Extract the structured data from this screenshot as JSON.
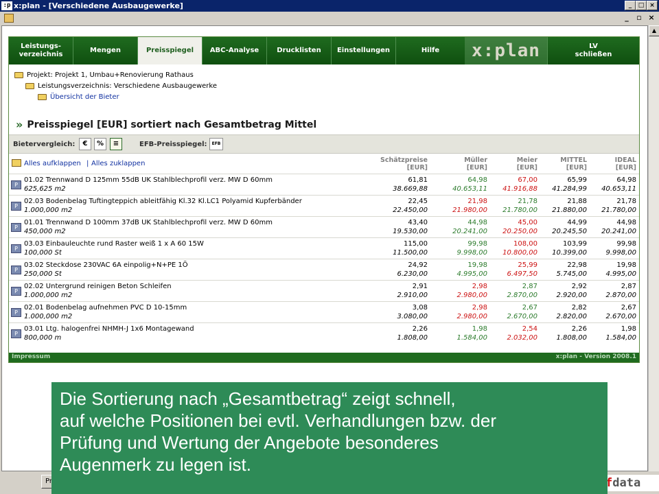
{
  "window": {
    "app_icon": ":p",
    "title": "x:plan - [Verschiedene Ausbaugewerke]"
  },
  "nav": {
    "items": [
      {
        "label": "Leistungs-\nverzeichnis"
      },
      {
        "label": "Mengen"
      },
      {
        "label": "Preisspiegel"
      },
      {
        "label": "ABC-Analyse"
      },
      {
        "label": "Drucklisten"
      },
      {
        "label": "Einstellungen"
      },
      {
        "label": "Hilfe"
      }
    ],
    "logo": "x:plan",
    "close_lv": "LV\nschließen"
  },
  "breadcrumb": {
    "project": "Projekt: Projekt 1, Umbau+Renovierung Rathaus",
    "lv": "Leistungsverzeichnis: Verschiedene Ausbaugewerke",
    "bidders": "Übersicht der Bieter"
  },
  "heading": {
    "raquo": "»",
    "text": "Preisspiegel [EUR] sortiert nach Gesamtbetrag Mittel"
  },
  "toolbar": {
    "bieter_label": "Bietervergleich:",
    "btn_euro": "€",
    "btn_percent": "%",
    "btn_list": "≡",
    "efb_label": "EFB-Preisspiegel:",
    "btn_efb": "EFB"
  },
  "expand": {
    "expand_all": "Alles aufklappen",
    "sep": "|",
    "collapse_all": "Alles zuklappen"
  },
  "columns": [
    {
      "line1": "Schätzpreise",
      "line2": "[EUR]"
    },
    {
      "line1": "Müller",
      "line2": "[EUR]"
    },
    {
      "line1": "Meier",
      "line2": "[EUR]"
    },
    {
      "line1": "MITTEL",
      "line2": "[EUR]"
    },
    {
      "line1": "IDEAL",
      "line2": "[EUR]"
    }
  ],
  "rows": [
    {
      "desc": "01.02 Trennwand D 125mm 55dB UK Stahlblechprofil verz. MW D 60mm",
      "qty": "625,625 m2",
      "ep": [
        "61,81",
        "64,98",
        "67,00",
        "65,99",
        "64,98"
      ],
      "gp": [
        "38.669,88",
        "40.653,11",
        "41.916,88",
        "41.284,99",
        "40.653,11"
      ],
      "colors": [
        "black",
        "green",
        "red",
        "black",
        "black"
      ]
    },
    {
      "desc": "02.03 Bodenbelag Tuftingteppich ableitfähig Kl.32 Kl.LC1 Polyamid Kupferbänder",
      "qty": "1.000,000 m2",
      "ep": [
        "22,45",
        "21,98",
        "21,78",
        "21,88",
        "21,78"
      ],
      "gp": [
        "22.450,00",
        "21.980,00",
        "21.780,00",
        "21.880,00",
        "21.780,00"
      ],
      "colors": [
        "black",
        "red",
        "green",
        "black",
        "black"
      ]
    },
    {
      "desc": "01.01 Trennwand D 100mm 37dB UK Stahlblechprofil verz. MW D 60mm",
      "qty": "450,000 m2",
      "ep": [
        "43,40",
        "44,98",
        "45,00",
        "44,99",
        "44,98"
      ],
      "gp": [
        "19.530,00",
        "20.241,00",
        "20.250,00",
        "20.245,50",
        "20.241,00"
      ],
      "colors": [
        "black",
        "green",
        "red",
        "black",
        "black"
      ]
    },
    {
      "desc": "03.03 Einbauleuchte rund Raster weiß 1 x A 60 15W",
      "qty": "100,000 St",
      "ep": [
        "115,00",
        "99,98",
        "108,00",
        "103,99",
        "99,98"
      ],
      "gp": [
        "11.500,00",
        "9.998,00",
        "10.800,00",
        "10.399,00",
        "9.998,00"
      ],
      "colors": [
        "black",
        "green",
        "red",
        "black",
        "black"
      ]
    },
    {
      "desc": "03.02 Steckdose 230VAC 6A einpolig+N+PE 1Ö",
      "qty": "250,000 St",
      "ep": [
        "24,92",
        "19,98",
        "25,99",
        "22,98",
        "19,98"
      ],
      "gp": [
        "6.230,00",
        "4.995,00",
        "6.497,50",
        "5.745,00",
        "4.995,00"
      ],
      "colors": [
        "black",
        "green",
        "red",
        "black",
        "black"
      ]
    },
    {
      "desc": "02.02 Untergrund reinigen Beton Schleifen",
      "qty": "1.000,000 m2",
      "ep": [
        "2,91",
        "2,98",
        "2,87",
        "2,92",
        "2,87"
      ],
      "gp": [
        "2.910,00",
        "2.980,00",
        "2.870,00",
        "2.920,00",
        "2.870,00"
      ],
      "colors": [
        "black",
        "red",
        "green",
        "black",
        "black"
      ]
    },
    {
      "desc": "02.01 Bodenbelag aufnehmen PVC D 10-15mm",
      "qty": "1.000,000 m2",
      "ep": [
        "3,08",
        "2,98",
        "2,67",
        "2,82",
        "2,67"
      ],
      "gp": [
        "3.080,00",
        "2.980,00",
        "2.670,00",
        "2.820,00",
        "2.670,00"
      ],
      "colors": [
        "black",
        "red",
        "green",
        "black",
        "black"
      ]
    },
    {
      "desc": "03.01 Ltg. halogenfrei NHMH-J 1x6 Montagewand",
      "qty": "800,000 m",
      "ep": [
        "2,26",
        "1,98",
        "2,54",
        "2,26",
        "1,98"
      ],
      "gp": [
        "1.808,00",
        "1.584,00",
        "2.032,00",
        "1.808,00",
        "1.584,00"
      ],
      "colors": [
        "black",
        "green",
        "red",
        "black",
        "black"
      ]
    }
  ],
  "footer": {
    "left": "Impressum",
    "right": "x:plan - Version 2008.1"
  },
  "taskbar": {
    "button": "Pr",
    "logo_f": "f",
    "logo_rest": "data"
  },
  "note": {
    "lines": [
      "Die Sortierung nach „Gesamtbetrag“ zeigt schnell,",
      "auf welche Positionen bei evtl. Verhandlungen bzw. der",
      "Prüfung und Wertung der Angebote besonderes",
      "Augenmerk zu legen ist."
    ]
  }
}
